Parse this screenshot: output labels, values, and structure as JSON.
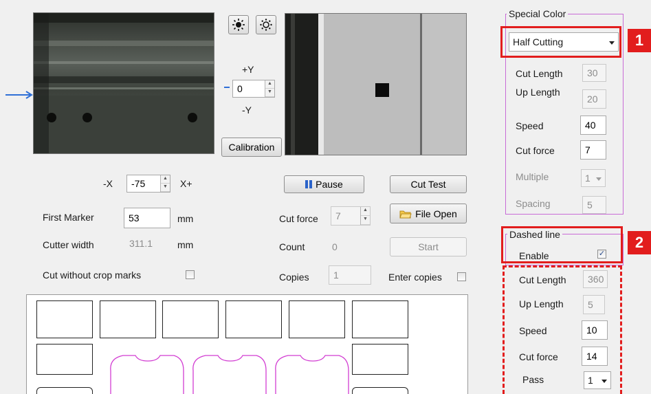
{
  "camera": {
    "plus_y": "+Y",
    "minus_y": "-Y",
    "y_offset": "0",
    "calibration": "Calibration",
    "minus_x": "-X",
    "plus_x": "X+",
    "x_offset": "-75"
  },
  "controls": {
    "pause": "Pause",
    "cut_test": "Cut Test",
    "file_open": "File Open",
    "start": "Start",
    "cut_force_label": "Cut force",
    "cut_force_value": "7",
    "count_label": "Count",
    "count_value": "0",
    "copies_label": "Copies",
    "copies_value": "1",
    "enter_copies": "Enter copies"
  },
  "marker": {
    "first_marker_label": "First Marker",
    "first_marker_value": "53",
    "first_marker_unit": "mm",
    "cutter_width_label": "Cutter width",
    "cutter_width_value": "311.1",
    "cutter_width_unit": "mm",
    "cut_without_crop": "Cut without crop marks"
  },
  "special_color": {
    "title": "Special Color",
    "mode": "Half Cutting",
    "cut_length_label": "Cut Length",
    "cut_length_value": "30",
    "up_length_label": "Up Length",
    "up_length_value": "20",
    "speed_label": "Speed",
    "speed_value": "40",
    "cut_force_label": "Cut force",
    "cut_force_value": "7",
    "multiple_label": "Multiple",
    "multiple_value": "1",
    "spacing_label": "Spacing",
    "spacing_value": "5"
  },
  "dashed_line": {
    "title": "Dashed line",
    "enable_label": "Enable",
    "enabled": true,
    "cut_length_label": "Cut Length",
    "cut_length_value": "360",
    "up_length_label": "Up Length",
    "up_length_value": "5",
    "speed_label": "Speed",
    "speed_value": "10",
    "cut_force_label": "Cut force",
    "cut_force_value": "14",
    "pass_label": "Pass",
    "pass_value": "1"
  },
  "badges": {
    "one": "1",
    "two": "2"
  },
  "colors": {
    "callout_red": "#e21d1d",
    "group_border": "#c86bd6",
    "shape_magenta": "#d23cd2",
    "pause_icon_blue": "#2b63c9",
    "arrow_blue": "#2f6fd6"
  }
}
